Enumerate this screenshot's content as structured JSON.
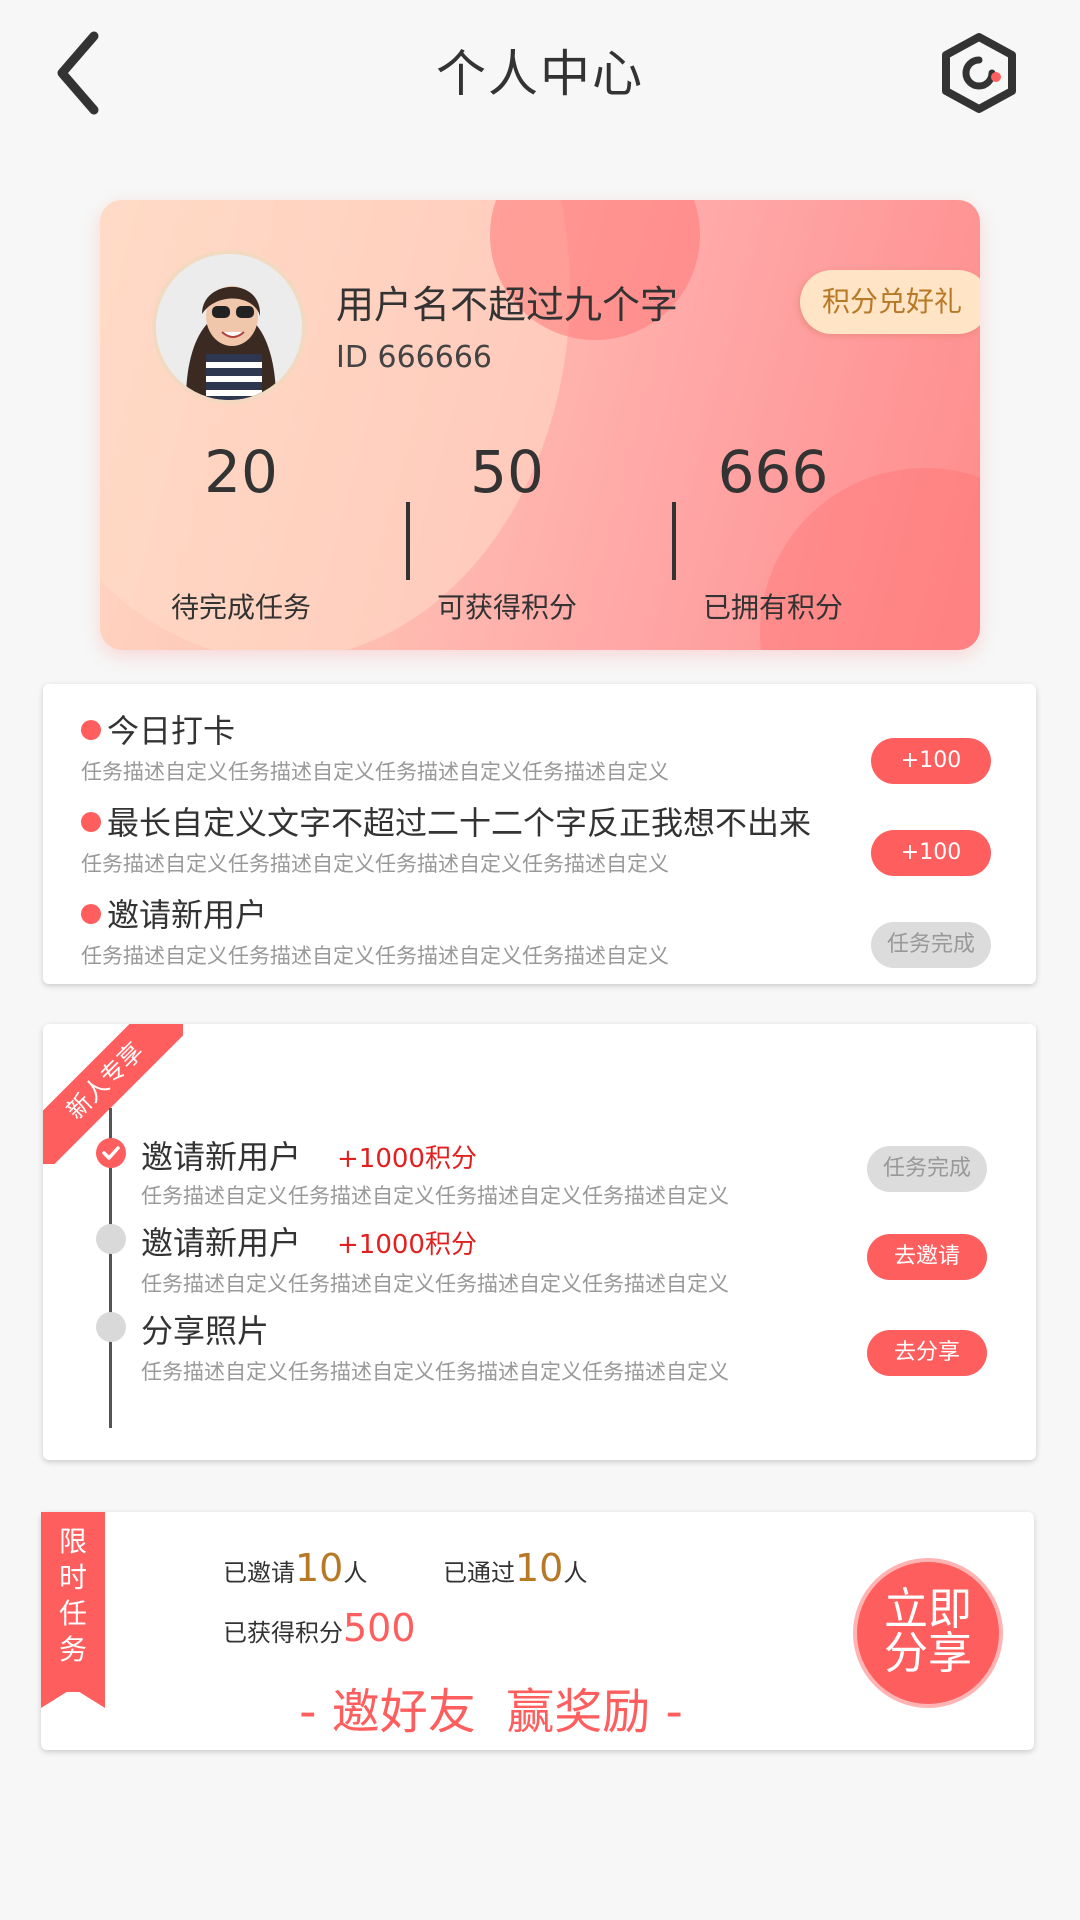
{
  "header": {
    "title": "个人中心",
    "back_icon": "chevron-left-icon",
    "settings_icon": "hexagon-settings-icon"
  },
  "profile": {
    "username": "用户名不超过九个字",
    "user_id": "ID 666666",
    "redeem_label": "积分兑好礼",
    "stats": [
      {
        "value": "20",
        "label": "待完成任务"
      },
      {
        "value": "50",
        "label": "可获得积分"
      },
      {
        "value": "666",
        "label": "已拥有积分"
      }
    ]
  },
  "daily_tasks": [
    {
      "title": "今日打卡",
      "desc": "任务描述自定义任务描述自定义任务描述自定义任务描述自定义",
      "action": "+100",
      "done": false
    },
    {
      "title": "最长自定义文字不超过二十二个字反正我想不出来",
      "desc": "任务描述自定义任务描述自定义任务描述自定义任务描述自定义",
      "action": "+100",
      "done": false
    },
    {
      "title": "邀请新用户",
      "desc": "任务描述自定义任务描述自定义任务描述自定义任务描述自定义",
      "action": "任务完成",
      "done": true
    }
  ],
  "newbie": {
    "ribbon": "新人专享",
    "tasks": [
      {
        "title": "邀请新用户",
        "points": "+1000积分",
        "desc": "任务描述自定义任务描述自定义任务描述自定义任务描述自定义",
        "action": "任务完成",
        "done": true
      },
      {
        "title": "邀请新用户",
        "points": "+1000积分",
        "desc": "任务描述自定义任务描述自定义任务描述自定义任务描述自定义",
        "action": "去邀请",
        "done": false
      },
      {
        "title": "分享照片",
        "points": "",
        "desc": "任务描述自定义任务描述自定义任务描述自定义任务描述自定义",
        "action": "去分享",
        "done": false
      }
    ]
  },
  "limited": {
    "tag_chars": [
      "限",
      "时",
      "任",
      "务"
    ],
    "invited_prefix": "已邀请",
    "invited_count": "10",
    "invited_suffix": "人",
    "passed_prefix": "已通过",
    "passed_count": "10",
    "passed_suffix": "人",
    "earned_prefix": "已获得积分",
    "earned_points": "500",
    "slogan": "- 邀好友  赢奖励 -",
    "share_line1": "立即",
    "share_line2": "分享"
  },
  "colors": {
    "accent": "#fe5e5e",
    "gold": "#b87926",
    "done_gray": "#dcdcdc"
  }
}
